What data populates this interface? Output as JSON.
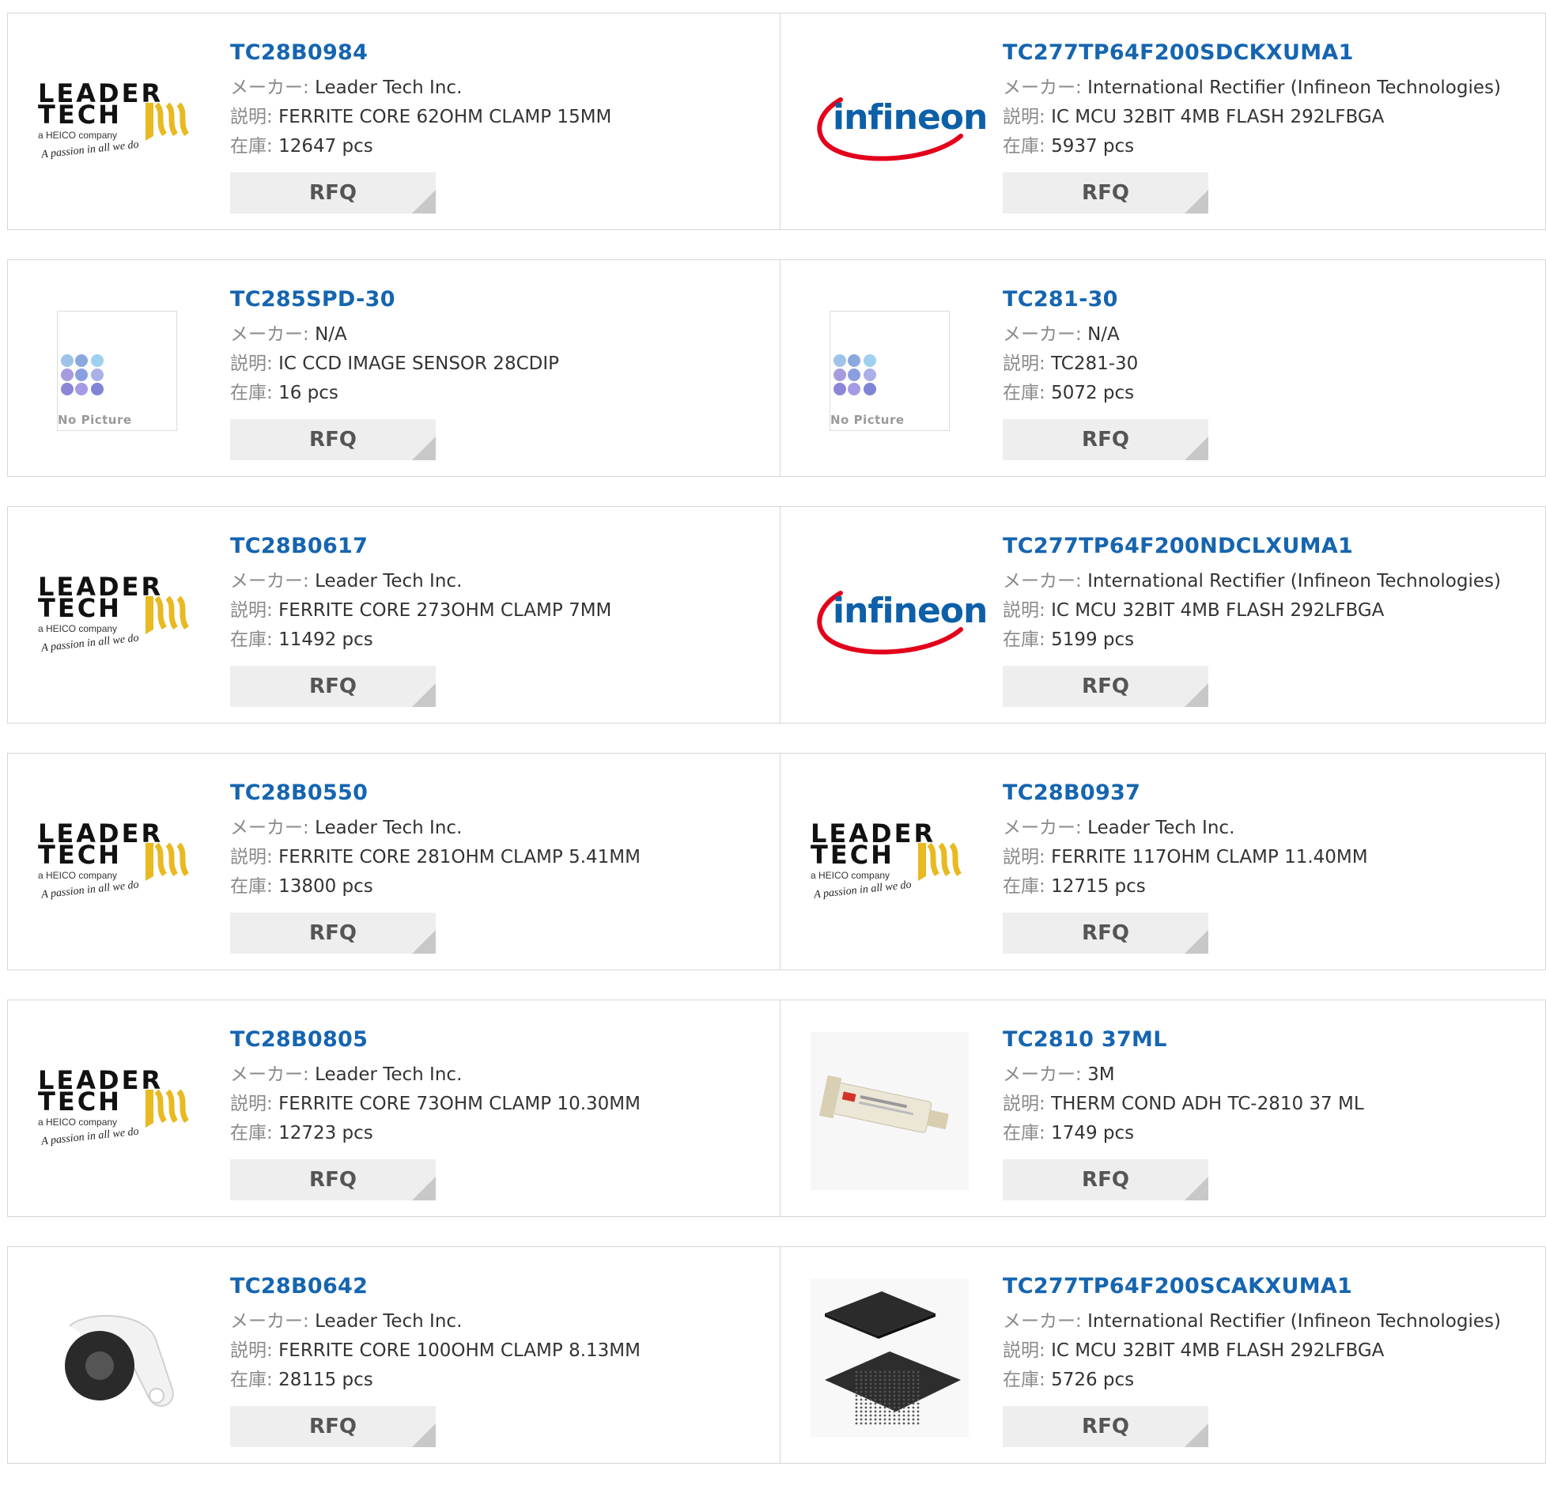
{
  "labels": {
    "maker": "メーカー:",
    "desc": "説明:",
    "stock": "在庫:",
    "rfq": "RFQ",
    "no_picture": "No Picture"
  },
  "brands": {
    "leader_line1": "LEADER",
    "leader_line2": "TECH",
    "leader_sub": "a HEICO company",
    "leader_tag": "A passion in all we do",
    "infineon": "infineon"
  },
  "colors": {
    "link": "#1565b0",
    "button_bg": "#eeeeee",
    "infineon_arc": "#e3001b"
  },
  "products": [
    {
      "pn": "TC28B0984",
      "maker": "Leader Tech Inc.",
      "desc": "FERRITE CORE 62OHM CLAMP 15MM",
      "stock": "12647 pcs",
      "image": "leader-tech-logo"
    },
    {
      "pn": "TC277TP64F200SDCKXUMA1",
      "maker": "International Rectifier (Infineon Technologies)",
      "desc": "IC MCU 32BIT 4MB FLASH 292LFBGA",
      "stock": "5937 pcs",
      "image": "infineon-logo"
    },
    {
      "pn": "TC285SPD-30",
      "maker": "N/A",
      "desc": "IC CCD IMAGE SENSOR 28CDIP",
      "stock": "16 pcs",
      "image": "no-picture"
    },
    {
      "pn": "TC281-30",
      "maker": "N/A",
      "desc": "TC281-30",
      "stock": "5072 pcs",
      "image": "no-picture"
    },
    {
      "pn": "TC28B0617",
      "maker": "Leader Tech Inc.",
      "desc": "FERRITE CORE 273OHM CLAMP 7MM",
      "stock": "11492 pcs",
      "image": "leader-tech-logo"
    },
    {
      "pn": "TC277TP64F200NDCLXUMA1",
      "maker": "International Rectifier (Infineon Technologies)",
      "desc": "IC MCU 32BIT 4MB FLASH 292LFBGA",
      "stock": "5199 pcs",
      "image": "infineon-logo"
    },
    {
      "pn": "TC28B0550",
      "maker": "Leader Tech Inc.",
      "desc": "FERRITE CORE 281OHM CLAMP 5.41MM",
      "stock": "13800 pcs",
      "image": "leader-tech-logo"
    },
    {
      "pn": "TC28B0937",
      "maker": "Leader Tech Inc.",
      "desc": "FERRITE 117OHM CLAMP 11.40MM",
      "stock": "12715 pcs",
      "image": "leader-tech-logo"
    },
    {
      "pn": "TC28B0805",
      "maker": "Leader Tech Inc.",
      "desc": "FERRITE CORE 73OHM CLAMP 10.30MM",
      "stock": "12723 pcs",
      "image": "leader-tech-logo"
    },
    {
      "pn": "TC2810 37ML",
      "maker": "3M",
      "desc": "THERM COND ADH TC-2810 37 ML",
      "stock": "1749 pcs",
      "image": "adhesive-cartridge-photo"
    },
    {
      "pn": "TC28B0642",
      "maker": "Leader Tech Inc.",
      "desc": "FERRITE CORE 100OHM CLAMP 8.13MM",
      "stock": "28115 pcs",
      "image": "ferrite-clamp-photo"
    },
    {
      "pn": "TC277TP64F200SCAKXUMA1",
      "maker": "International Rectifier (Infineon Technologies)",
      "desc": "IC MCU 32BIT 4MB FLASH 292LFBGA",
      "stock": "5726 pcs",
      "image": "bga-chip-photo"
    }
  ]
}
